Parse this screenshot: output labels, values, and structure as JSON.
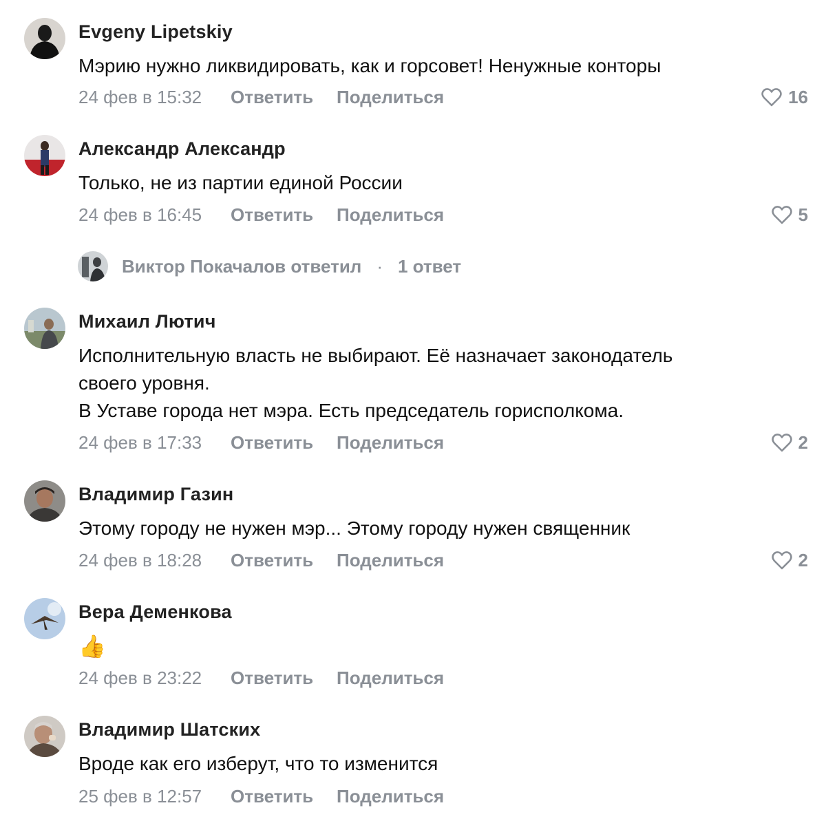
{
  "actions": {
    "reply_label": "Ответить",
    "share_label": "Поделиться"
  },
  "comments": [
    {
      "author": "Evgeny Lipetskiy",
      "lines": [
        "Мэрию нужно ликвидировать, как и горсовет! Ненужные конторы"
      ],
      "date": "24 фев в 15:32",
      "likes": "16",
      "avatar_icon": "user-photo"
    },
    {
      "author": "Александр Александр",
      "lines": [
        "Только, не из партии единой России"
      ],
      "date": "24 фев в 16:45",
      "likes": "5",
      "avatar_icon": "user-photo"
    },
    {
      "author": "Михаил Лютич",
      "lines": [
        "Исполнительную власть не выбирают. Её назначает законодатель",
        "своего уровня.",
        "В Уставе города нет мэра. Есть председатель горисполкома."
      ],
      "date": "24 фев в 17:33",
      "likes": "2",
      "avatar_icon": "user-photo"
    },
    {
      "author": "Владимир Газин",
      "lines": [
        "Этому городу не нужен мэр... Этому городу нужен священник"
      ],
      "date": "24 фев в 18:28",
      "likes": "2",
      "avatar_icon": "user-photo"
    },
    {
      "author": "Вера Деменкова",
      "lines": [
        "👍"
      ],
      "date": "24 фев в 23:22",
      "likes": "",
      "avatar_icon": "user-photo"
    },
    {
      "author": "Владимир Шатских",
      "lines": [
        "Вроде как его изберут, что то изменится"
      ],
      "date": "25 фев в 12:57",
      "likes": "",
      "avatar_icon": "user-photo"
    }
  ],
  "thread": {
    "replier": "Виктор Покачалов ответил",
    "separator": "·",
    "count_label": "1 ответ",
    "avatar_icon": "user-photo"
  },
  "icons": {
    "like": "heart-icon"
  },
  "colors": {
    "meta": "#8a8f96",
    "text": "#111111"
  }
}
